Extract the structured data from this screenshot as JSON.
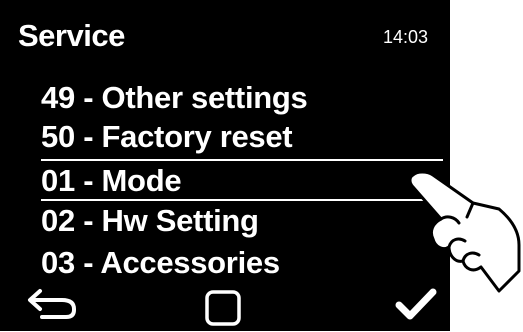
{
  "header": {
    "title": "Service",
    "clock": "14:03"
  },
  "menu": {
    "items": [
      {
        "label": "49 - Other settings"
      },
      {
        "label": "50 - Factory reset"
      },
      {
        "label": "01 - Mode",
        "selected": true
      },
      {
        "label": "02 - Hw Setting"
      },
      {
        "label": "03 - Accessories"
      }
    ]
  },
  "footer": {
    "icons": [
      "back-arrow-icon",
      "home-square-icon",
      "checkmark-icon"
    ]
  },
  "colors": {
    "screen_background": "#000000",
    "text": "#ffffff",
    "page_background": "#ffffff"
  }
}
